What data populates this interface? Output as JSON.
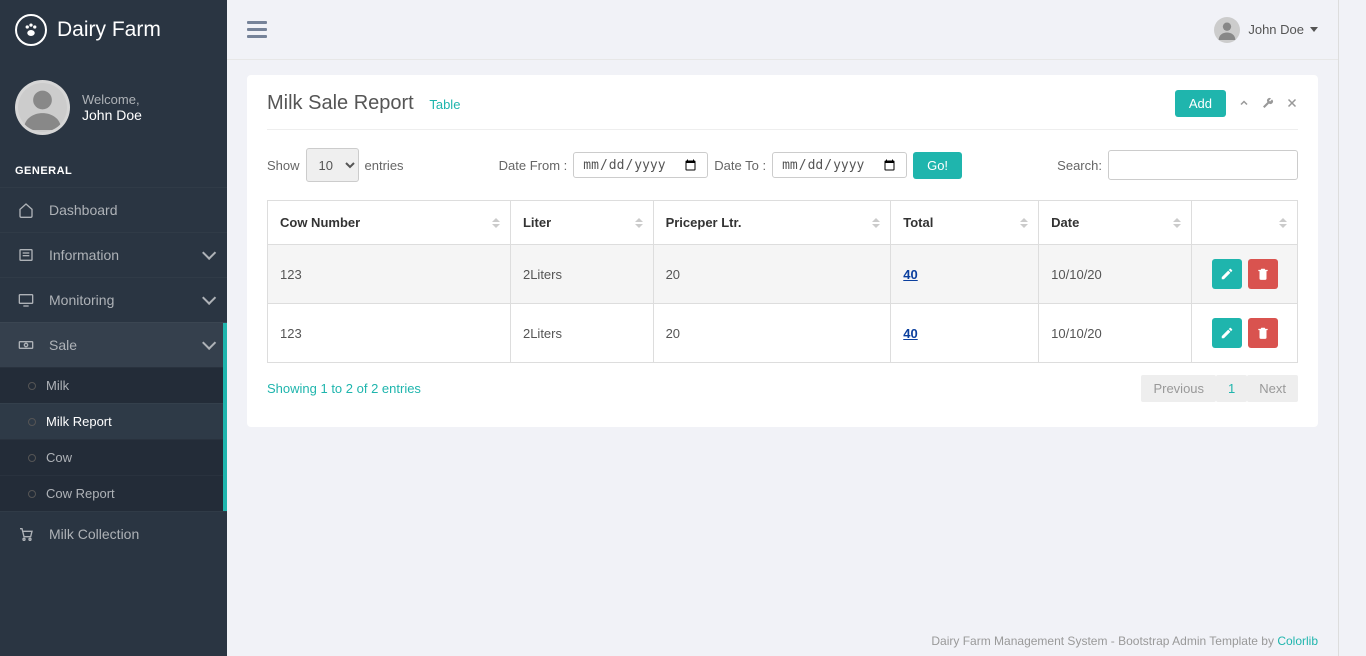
{
  "brand": {
    "title": "Dairy Farm"
  },
  "profile": {
    "welcome": "Welcome,",
    "name": "John Doe"
  },
  "sidebar": {
    "section": "GENERAL",
    "items": [
      {
        "label": "Dashboard"
      },
      {
        "label": "Information"
      },
      {
        "label": "Monitoring"
      },
      {
        "label": "Sale"
      },
      {
        "label": "Milk Collection"
      }
    ],
    "sale_submenu": [
      {
        "label": "Milk"
      },
      {
        "label": "Milk Report"
      },
      {
        "label": "Cow"
      },
      {
        "label": "Cow Report"
      }
    ]
  },
  "topbar": {
    "username": "John Doe"
  },
  "panel": {
    "title": "Milk Sale Report",
    "subtitle": "Table",
    "add_label": "Add"
  },
  "filters": {
    "show_label": "Show",
    "entries_label": "entries",
    "page_size": "10",
    "date_from_label": "Date From :",
    "date_to_label": "Date To :",
    "date_placeholder": "mm/dd/yyyy",
    "go_label": "Go!",
    "search_label": "Search:"
  },
  "table": {
    "columns": [
      "Cow Number",
      "Liter",
      "Priceper Ltr.",
      "Total",
      "Date",
      ""
    ],
    "rows": [
      {
        "cow_number": "123",
        "liter": "2Liters",
        "price_per_ltr": "20",
        "total": "40",
        "date": "10/10/20"
      },
      {
        "cow_number": "123",
        "liter": "2Liters",
        "price_per_ltr": "20",
        "total": "40",
        "date": "10/10/20"
      }
    ],
    "info": "Showing 1 to 2 of 2 entries",
    "prev": "Previous",
    "page": "1",
    "next": "Next"
  },
  "footer": {
    "text": "Dairy Farm Management System - Bootstrap Admin Template by ",
    "link": "Colorlib"
  }
}
